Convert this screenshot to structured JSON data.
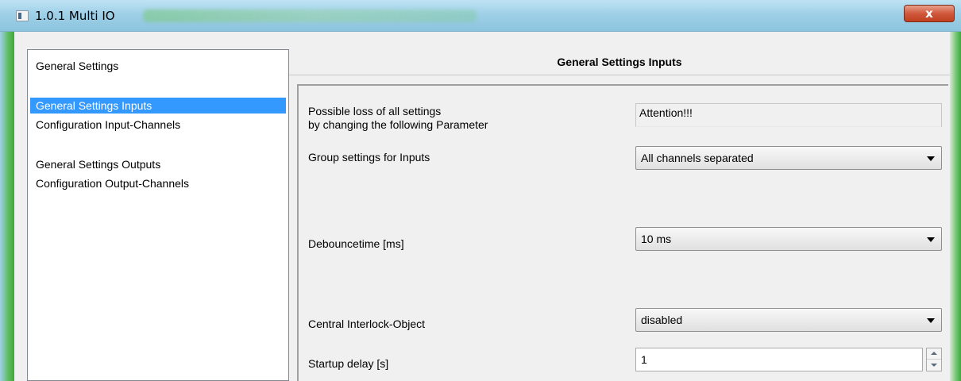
{
  "window": {
    "title": "1.0.1 Multi IO",
    "close_label": "x"
  },
  "nav": {
    "items": [
      {
        "label": "General Settings",
        "selected": false
      },
      {
        "label": "General Settings Inputs",
        "selected": true
      },
      {
        "label": "Configuration Input-Channels",
        "selected": false
      },
      {
        "label": "General Settings Outputs",
        "selected": false
      },
      {
        "label": "Configuration Output-Channels",
        "selected": false
      }
    ]
  },
  "main": {
    "title": "General Settings Inputs",
    "params": [
      {
        "label_line1": "Possible loss of all settings",
        "label_line2": "by changing the following Parameter",
        "value": "Attention!!!"
      },
      {
        "label": "Group settings for Inputs",
        "value": "All channels separated"
      },
      {
        "label": "Debouncetime [ms]",
        "value": "10 ms"
      },
      {
        "label": "Central Interlock-Object",
        "value": "disabled"
      },
      {
        "label": "Startup delay [s]",
        "value": "1"
      }
    ]
  }
}
